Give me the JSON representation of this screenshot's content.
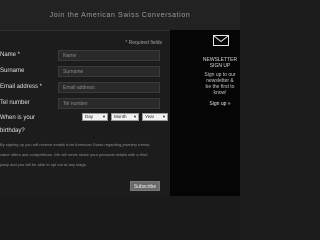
{
  "header": {
    "title": "Join the American Swiss Conversation"
  },
  "form": {
    "required_note": "* Required fields",
    "fields": [
      {
        "label": "Name *",
        "placeholder": "Name"
      },
      {
        "label": "Surname",
        "placeholder": "Surname"
      },
      {
        "label": "Email address *",
        "placeholder": "Email address"
      },
      {
        "label": "Tel number",
        "placeholder": "Tel number"
      }
    ],
    "birthday": {
      "label_line1": "When is your",
      "label_line2": "birthday?",
      "day": "Day",
      "month": "Month",
      "year": "Year"
    },
    "legal": [
      "By signing up you will receive emails from American Swiss regarding jewelery trends,",
      "value offers and competitions. We will never share your personal details with a third",
      "party and you will be able to opt out at any stage."
    ],
    "subscribe_label": "Subscribe"
  },
  "sidebar": {
    "icon": "envelope-icon",
    "title_line1": "NEWSLETTER",
    "title_line2": "SIGN UP",
    "body": [
      "Sign up to our",
      "newsletter &",
      "be the first to",
      "know!"
    ],
    "link": "Sign up »"
  },
  "colors": {
    "background": "#1c1c1c",
    "sidebar": "#050505",
    "field": "#2a2a2a",
    "button": "#6a6a6a"
  }
}
